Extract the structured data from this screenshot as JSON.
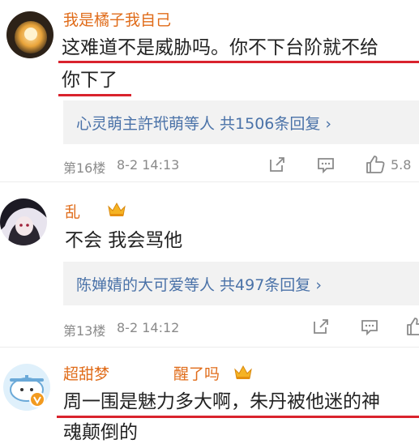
{
  "comments": [
    {
      "username": "我是橘子我自己",
      "text_line1": "这难道不是威胁吗。你不下台阶就不给",
      "text_line2": "你下了",
      "reply_summary": "心灵萌主許玳萌等人 共1506条回复 ›",
      "floor": "第16楼",
      "time": "8-2 14:13",
      "likes": "5.8"
    },
    {
      "username": "乱",
      "text_line1": "不会 我会骂他",
      "reply_summary": "陈婵婧的大可爱等人 共497条回复 ›",
      "floor": "第13楼",
      "time": "8-2 14:12"
    },
    {
      "username": "超甜梦",
      "username_tail": "醒了吗",
      "text_line1": "周一围是魅力多大啊，朱丹被他迷的神",
      "text_line2": "魂颠倒的"
    }
  ],
  "colors": {
    "username": "#e06c1a",
    "reply_link": "#4a72a8",
    "underline": "#d9232d",
    "meta": "#8a8a8a",
    "reply_bg": "#f2f2f2"
  },
  "icons": [
    "share-icon",
    "comment-icon",
    "like-icon",
    "crown-badge-icon",
    "verified-badge-icon"
  ]
}
